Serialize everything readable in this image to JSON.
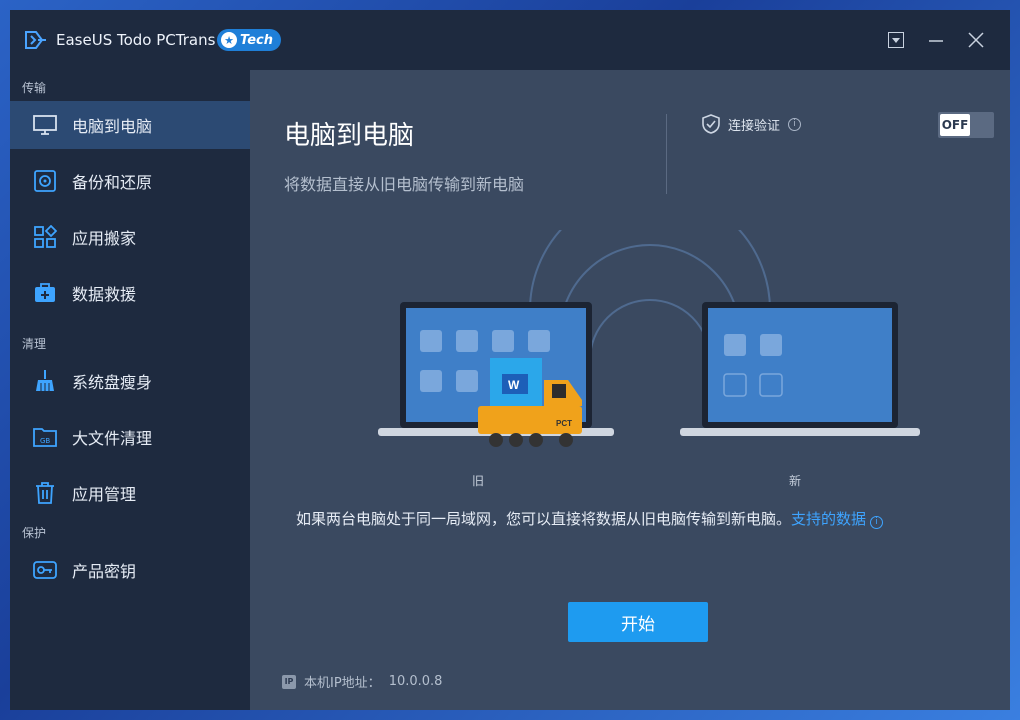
{
  "window": {
    "app_title": "EaseUS Todo PCTrans",
    "badge": "Tech"
  },
  "sidebar": {
    "sections": [
      {
        "label": "传输"
      },
      {
        "label": "清理"
      },
      {
        "label": "保护"
      }
    ],
    "items": [
      {
        "label": "电脑到电脑",
        "icon": "monitor-icon",
        "active": true
      },
      {
        "label": "备份和还原",
        "icon": "backup-icon"
      },
      {
        "label": "应用搬家",
        "icon": "apps-icon"
      },
      {
        "label": "数据救援",
        "icon": "rescue-icon"
      },
      {
        "label": "系统盘瘦身",
        "icon": "broom-icon"
      },
      {
        "label": "大文件清理",
        "icon": "folder-gb-icon"
      },
      {
        "label": "应用管理",
        "icon": "trash-icon"
      },
      {
        "label": "产品密钥",
        "icon": "key-icon"
      }
    ]
  },
  "main": {
    "title": "电脑到电脑",
    "subtitle": "将数据直接从旧电脑传输到新电脑",
    "verify_label": "连接验证",
    "toggle_state": "OFF",
    "illustration": {
      "old_label": "旧",
      "new_label": "新",
      "truck_label": "PCT"
    },
    "description": "如果两台电脑处于同一局域网，您可以直接将数据从旧电脑传输到新电脑。",
    "link": "支持的数据",
    "start_button": "开始",
    "ip_badge": "IP",
    "ip_label": "本机IP地址：",
    "ip_value": "10.0.0.8"
  },
  "colors": {
    "titlebar": "#1e2a3f",
    "sidebar": "#1e2a3f",
    "active_item": "#2c4a73",
    "main_bg": "#3a4960",
    "accent": "#1e9bf0",
    "link": "#3ea4ff"
  }
}
